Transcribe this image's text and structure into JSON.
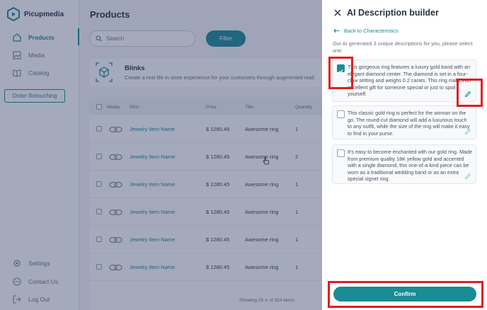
{
  "app": {
    "name": "Picupmedia"
  },
  "sidebar": {
    "items": [
      {
        "label": "Products",
        "icon": "products-icon"
      },
      {
        "label": "Media",
        "icon": "media-icon"
      },
      {
        "label": "Catalog",
        "icon": "catalog-icon"
      }
    ],
    "order_button": "Order Retouching",
    "bottom": [
      {
        "label": "Settings",
        "icon": "gear-icon"
      },
      {
        "label": "Contact Us",
        "icon": "chat-icon"
      },
      {
        "label": "Log Out",
        "icon": "logout-icon"
      }
    ]
  },
  "main": {
    "title": "Products",
    "search_placeholder": "Search",
    "filter_label": "Filter",
    "banner": {
      "title": "Blinks",
      "subtitle": "Create a real life in store experience for your customers through augmented reali"
    },
    "table": {
      "headers": [
        "Media",
        "SKU",
        "Price",
        "Title",
        "Quantity"
      ],
      "rows": [
        {
          "name": "Jewelry Item Name",
          "price": "$ 1280.45",
          "title": "Awesome ring",
          "qty": "1"
        },
        {
          "name": "Jewelry Item Name",
          "price": "$ 1280.45",
          "title": "Awesome ring",
          "qty": "2"
        },
        {
          "name": "Jewelry Item Name",
          "price": "$ 1280.45",
          "title": "Awesome ring",
          "qty": "1"
        },
        {
          "name": "Jewelry Item Name",
          "price": "$ 1280.45",
          "title": "Awesome ring",
          "qty": "1"
        },
        {
          "name": "Jewelry Item Name",
          "price": "$ 1280.45",
          "title": "Awesome ring",
          "qty": "1"
        },
        {
          "name": "Jewelry Item Name",
          "price": "$ 1280.45",
          "title": "Awesome ring",
          "qty": "1"
        }
      ]
    },
    "showing": "Showing 15 ∨   of 324 items"
  },
  "drawer": {
    "title": "AI Description builder",
    "back_label": "Back to Characteristics",
    "intro": "Our AI generated 3 unique descriptions for you, please select one:",
    "options": [
      {
        "text": "This gorgeous ring features a luxury gold band with an elegant diamond center. The diamond is set in a four-claw setting and weighs 0.2 carats. This ring makes an excellent gift for someone special or just to spoil yourself.",
        "selected": true
      },
      {
        "text": "This classic gold ring is perfect for the woman on the go. The round-cut diamond will add a luxurious touch to any outfit, while the size of the ring will make it easy to find in your purse.",
        "selected": false
      },
      {
        "text": "It's easy to become enchanted with our gold ring. Made from premium quality 18K yellow gold and accented with a single diamond, this one-of-a-kind piece can be worn as a traditional wedding band or as an extra special signet ring.",
        "selected": false
      }
    ],
    "confirm_label": "Confirm"
  },
  "colors": {
    "accent": "#1a8c95",
    "highlight": "#e02020",
    "overlay": "rgba(40,50,95,0.42)"
  }
}
